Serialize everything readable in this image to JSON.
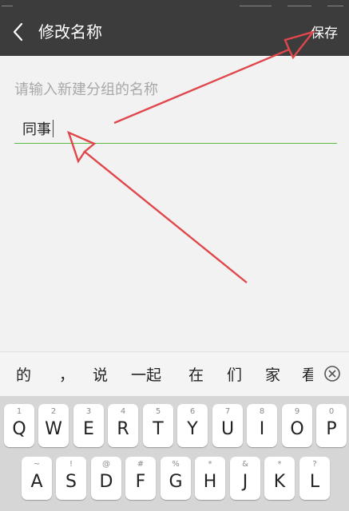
{
  "header": {
    "title": "修改名称",
    "save_label": "保存"
  },
  "form": {
    "placeholder_hint": "请输入新建分组的名称",
    "value": "同事"
  },
  "candidates": [
    "的",
    "，",
    "说",
    "一起",
    "在",
    "们",
    "家",
    "看"
  ],
  "keyboard": {
    "row1": [
      {
        "sub": "1",
        "label": "Q"
      },
      {
        "sub": "2",
        "label": "W"
      },
      {
        "sub": "3",
        "label": "E"
      },
      {
        "sub": "4",
        "label": "R"
      },
      {
        "sub": "5",
        "label": "T"
      },
      {
        "sub": "6",
        "label": "Y"
      },
      {
        "sub": "7",
        "label": "U"
      },
      {
        "sub": "8",
        "label": "I"
      },
      {
        "sub": "9",
        "label": "O"
      },
      {
        "sub": "0",
        "label": "P"
      }
    ],
    "row2": [
      {
        "sub": "~",
        "label": "A"
      },
      {
        "sub": "!",
        "label": "S"
      },
      {
        "sub": "@",
        "label": "D"
      },
      {
        "sub": "#",
        "label": "F"
      },
      {
        "sub": "%",
        "label": "G"
      },
      {
        "sub": "*",
        "label": "H"
      },
      {
        "sub": "&",
        "label": "J"
      },
      {
        "sub": "*",
        "label": "K"
      },
      {
        "sub": "?",
        "label": "L"
      }
    ]
  },
  "colors": {
    "header_bg": "#3c3c3c",
    "underline": "#5bbd3f",
    "annotation_arrow": "#e0474c"
  }
}
